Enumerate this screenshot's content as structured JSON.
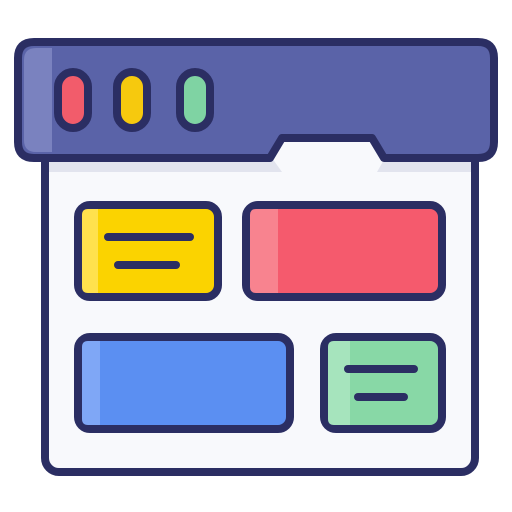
{
  "icon": {
    "semantic": "browser-window-layout-icon",
    "colors": {
      "outline": "#2b2e63",
      "titlebar": "#5a63a8",
      "titlebar_highlight": "#7a82bf",
      "window_body": "#f8f9fc",
      "window_tab_shadow": "#e2e4ee",
      "traffic_red": "#f25c6b",
      "traffic_yellow": "#f6c90e",
      "traffic_green": "#7fd3a3",
      "card_yellow": "#fbd300",
      "card_yellow_highlight": "#ffe14d",
      "card_red": "#f55a6d",
      "card_red_highlight": "#f8838f",
      "card_blue": "#5b8ff2",
      "card_blue_highlight": "#7fa7f6",
      "card_green": "#88d8a6",
      "card_green_highlight": "#a6e4bd"
    }
  }
}
